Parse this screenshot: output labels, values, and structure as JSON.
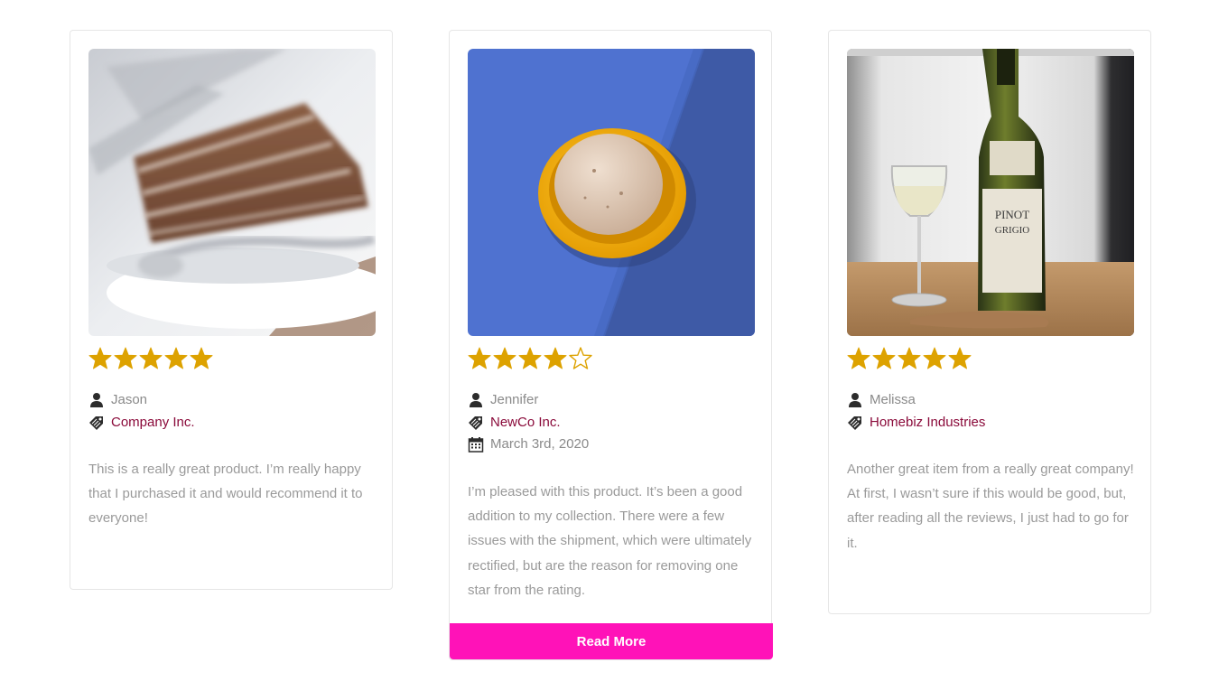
{
  "colors": {
    "star_fill": "#DDA200",
    "company_link": "#8A0A3A",
    "read_more_bg": "#FF12B8",
    "card_border": "#E6E6E6",
    "muted_text": "#9A9A9A"
  },
  "reviews": [
    {
      "photo_icon": "chocolate-cake-photo",
      "rating": 5,
      "rating_max": 5,
      "name": "Jason",
      "company": "Company Inc.",
      "text": "This is a really great product. I’m really happy that I purchased it and would recommend it to everyone!"
    },
    {
      "photo_icon": "ice-cream-bowl-photo",
      "rating": 4,
      "rating_max": 5,
      "name": "Jennifer",
      "company": "NewCo Inc.",
      "date": "March 3rd, 2020",
      "text": "I’m pleased with this product. It’s been a good addition to my collection. There were a few issues with the shipment, which were ultimately rectified, but are the reason for removing one star from the rating.",
      "read_more_label": "Read More"
    },
    {
      "photo_icon": "wine-bottle-photo",
      "rating": 5,
      "rating_max": 5,
      "name": "Melissa",
      "company": "Homebiz Industries",
      "text": "Another great item from a really great company! At first, I wasn’t sure if this would be good, but, after reading all the reviews, I just had to go for it."
    }
  ]
}
